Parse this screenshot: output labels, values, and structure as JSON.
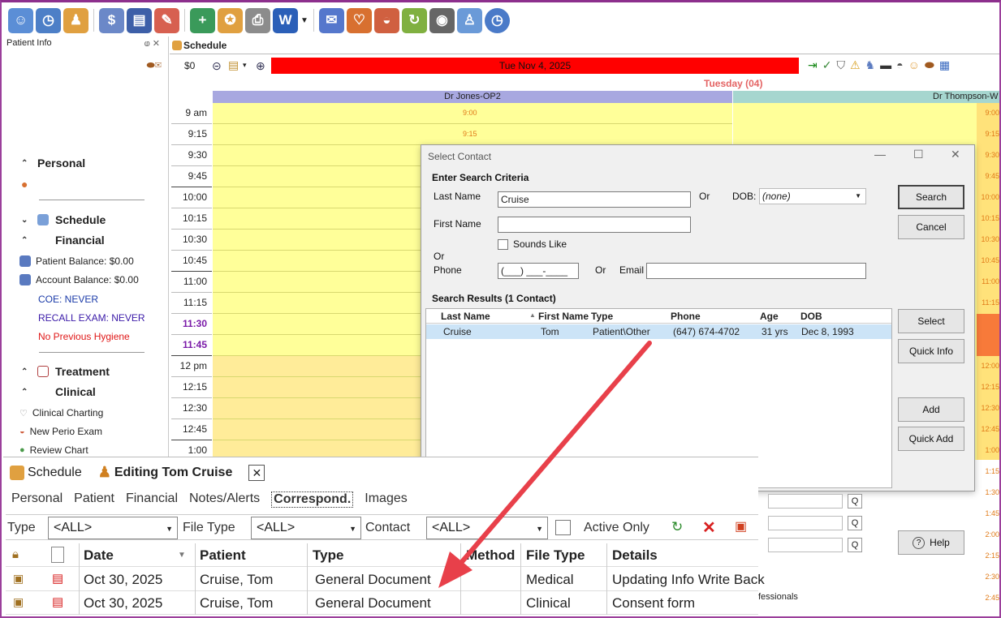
{
  "toolbar": {
    "icons": [
      "family-icon",
      "clock-money-icon",
      "users-icon",
      "billing-icon",
      "ledger-icon",
      "patient-report-icon",
      "add-appointment-icon",
      "certificate-icon",
      "printer-icon",
      "word-icon",
      "chat-icon",
      "tooth-icon",
      "perio-icon",
      "refresh-icon",
      "camera-icon",
      "user-icon",
      "clock-icon"
    ]
  },
  "left": {
    "header": "Patient Info",
    "pin": "ⱷ ✕",
    "sections": {
      "personal": "Personal",
      "schedule": "Schedule",
      "financial": "Financial",
      "treatment": "Treatment",
      "clinical": "Clinical"
    },
    "financial_items": [
      "Patient Balance: $0.00",
      "Account Balance: $0.00"
    ],
    "coe": "COE: NEVER",
    "recall": "RECALL EXAM: NEVER",
    "hygiene": "No Previous Hygiene",
    "clinical_items": [
      "Clinical Charting",
      "New Perio Exam",
      "Review Chart"
    ]
  },
  "schedule": {
    "tab": "Schedule",
    "amount": "$0",
    "date": "Tue Nov 4, 2025",
    "day": "Tuesday (04)",
    "provider1": "Dr Jones-OP2",
    "provider2": "Dr Thompson-W",
    "times": [
      "9 am",
      "9:15",
      "9:30",
      "9:45",
      "10:00",
      "10:15",
      "10:30",
      "10:45",
      "11:00",
      "11:15",
      "11:30",
      "11:45",
      "12 pm",
      "12:15",
      "12:30",
      "12:45",
      "1:00"
    ],
    "slot_labels": [
      "9:00",
      "9:15"
    ],
    "right_slots": [
      "9:00",
      "9:15",
      "9:30",
      "9:45",
      "10:00",
      "10:15",
      "10:30",
      "10:45",
      "11:00",
      "11:15",
      "",
      "",
      "12:00",
      "12:15",
      "12:30",
      "12:45",
      "1:00",
      "1:15",
      "1:30",
      "1:45",
      "2:00",
      "2:15",
      "2:30",
      "2:45"
    ]
  },
  "dialog": {
    "title": "Select Contact",
    "criteria": "Enter Search Criteria",
    "last_name_label": "Last Name",
    "last_name_value": "Cruise",
    "or1": "Or",
    "dob_label": "DOB:",
    "dob_value": "(none)",
    "first_name_label": "First Name",
    "first_name_value": "",
    "sounds_like": "Sounds Like",
    "or2": "Or",
    "phone_label": "Phone",
    "phone_value": "(___) ___-____",
    "or3": "Or",
    "email_label": "Email",
    "results_label": "Search Results (1 Contact)",
    "columns": [
      "Last Name",
      "First Name",
      "Type",
      "Phone",
      "Age",
      "DOB"
    ],
    "rows": [
      {
        "last": "Cruise",
        "first": "Tom",
        "type": "Patient\\Other",
        "phone": "(647) 674-4702",
        "age": "31 yrs",
        "dob": "Dec 8, 1993"
      }
    ],
    "buttons": {
      "search": "Search",
      "cancel": "Cancel",
      "select": "Select",
      "quick_info": "Quick Info",
      "add": "Add",
      "quick_add": "Quick Add",
      "help": "Help"
    },
    "footer_text": "fessionals"
  },
  "bottom": {
    "tab_schedule": "Schedule",
    "tab_editing": "Editing Tom Cruise",
    "subtabs": [
      "Personal",
      "Patient",
      "Financial",
      "Notes/Alerts",
      "Correspond.",
      "Images"
    ],
    "filter_type_label": "Type",
    "filter_type_value": "<ALL>",
    "filter_filetype_label": "File Type",
    "filter_filetype_value": "<ALL>",
    "filter_contact_label": "Contact",
    "filter_contact_value": "<ALL>",
    "active_only": "Active Only",
    "columns": [
      "Date",
      "Patient",
      "Type",
      "Method",
      "File Type",
      "Details"
    ],
    "rows": [
      {
        "date": "Oct 30, 2025",
        "patient": "Cruise, Tom",
        "type": "General Document",
        "method": "",
        "filetype": "Medical",
        "details": "Updating Info Write Back"
      },
      {
        "date": "Oct 30, 2025",
        "patient": "Cruise, Tom",
        "type": "General Document",
        "method": "",
        "filetype": "Clinical",
        "details": "Consent form"
      }
    ]
  },
  "colors": {
    "accent": "#9b3f9b",
    "arrow": "#e8404a",
    "date_bar": "#ff0000"
  }
}
